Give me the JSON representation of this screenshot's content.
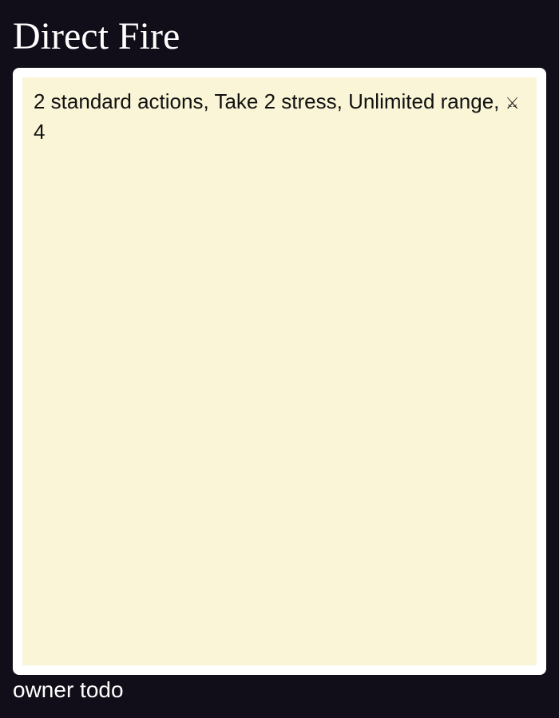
{
  "card": {
    "title": "Direct Fire",
    "description": "2 standard actions, Take 2 stress, Unlimited range,",
    "damage_icon": "crossed-swords-icon",
    "damage_glyph": "⚔",
    "damage_value": "4",
    "owner": "owner todo"
  },
  "colors": {
    "background": "#110e19",
    "card_frame": "#ffffff",
    "card_body": "#faf5d7",
    "title_text": "#ffffff",
    "body_text": "#111111"
  }
}
